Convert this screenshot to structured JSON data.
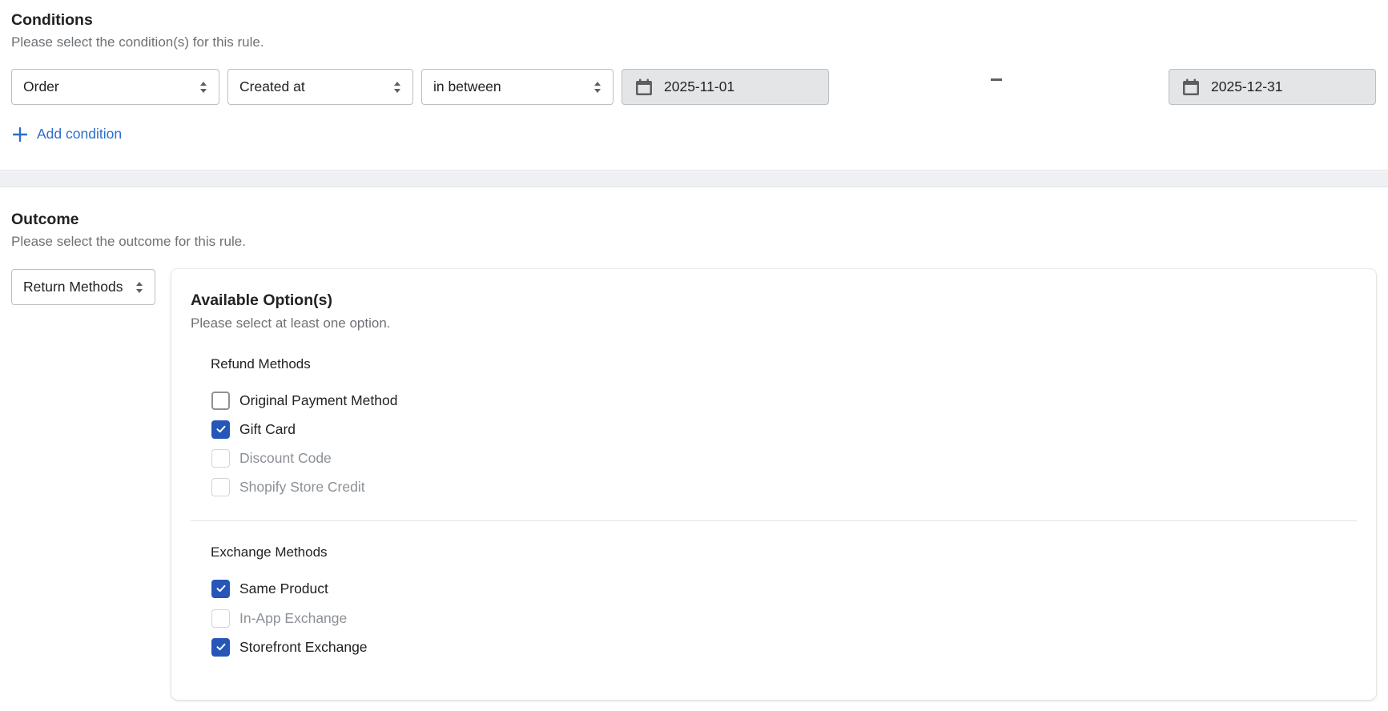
{
  "conditions": {
    "title": "Conditions",
    "subtitle": "Please select the condition(s) for this rule.",
    "entity_select": "Order",
    "field_select": "Created at",
    "operator_select": "in between",
    "start_date": "2025-11-01",
    "end_date": "2025-12-31",
    "add_condition_label": "Add condition"
  },
  "outcome": {
    "title": "Outcome",
    "subtitle": "Please select the outcome for this rule.",
    "type_select": "Return Methods",
    "card": {
      "title": "Available Option(s)",
      "subtitle": "Please select at least one option.",
      "refund_group": {
        "label": "Refund Methods",
        "options": [
          {
            "label": "Original Payment Method",
            "checked": false,
            "disabled": false
          },
          {
            "label": "Gift Card",
            "checked": true,
            "disabled": false
          },
          {
            "label": "Discount Code",
            "checked": false,
            "disabled": true
          },
          {
            "label": "Shopify Store Credit",
            "checked": false,
            "disabled": true
          }
        ]
      },
      "exchange_group": {
        "label": "Exchange Methods",
        "options": [
          {
            "label": "Same Product",
            "checked": true,
            "disabled": false
          },
          {
            "label": "In-App Exchange",
            "checked": false,
            "disabled": true
          },
          {
            "label": "Storefront Exchange",
            "checked": true,
            "disabled": false
          }
        ]
      }
    }
  },
  "colors": {
    "accent": "#2556b8",
    "link": "#2c6ecb",
    "muted_text": "#6d7175",
    "disabled_field_bg": "#e4e5e7"
  }
}
